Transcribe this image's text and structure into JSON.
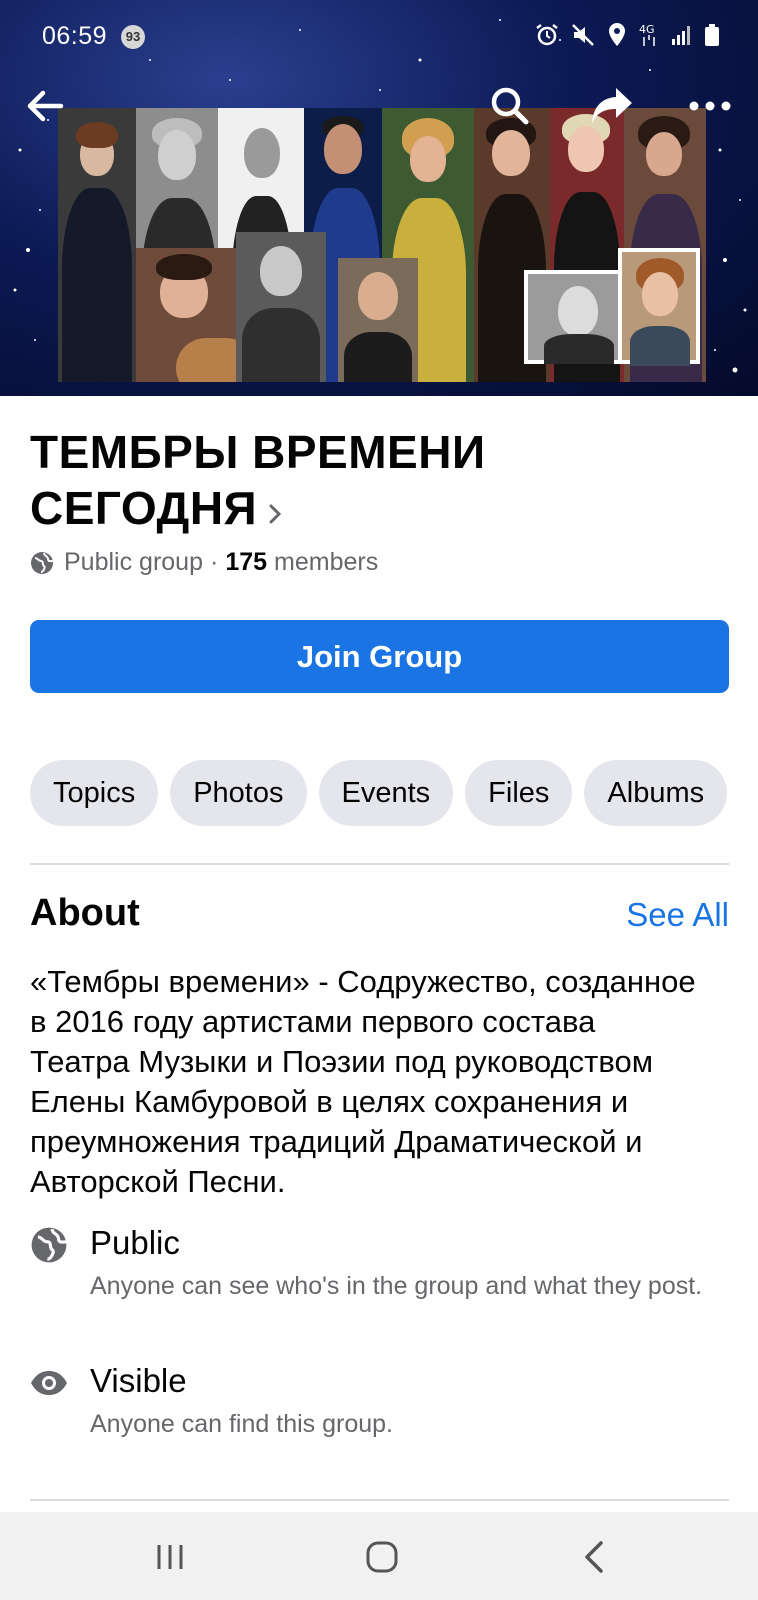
{
  "status_bar": {
    "time": "06:59",
    "notification_count": "93",
    "network": "4G"
  },
  "cover": {
    "actions": [
      "back-arrow-icon",
      "search-icon",
      "share-icon",
      "more-icon"
    ]
  },
  "group": {
    "title": "ТЕМБРЫ ВРЕМЕНИ СЕГОДНЯ",
    "privacy": "Public group",
    "separator": "·",
    "member_count": "175",
    "members_label": "members"
  },
  "join_button": "Join Group",
  "tabs": [
    {
      "label": "Topics"
    },
    {
      "label": "Photos"
    },
    {
      "label": "Events"
    },
    {
      "label": "Files"
    },
    {
      "label": "Albums"
    }
  ],
  "about": {
    "heading": "About",
    "see_all": "See All",
    "description": "«Тембры времени» - Содружество, созданное\nв 2016 году артистами первого состава\nТеатра Музыки  и Поэзии под руководством\nЕлены Камбуровой в целях сохранения и\nпреумножения традиций Драматической и\nАвторской  Песни.",
    "items": [
      {
        "icon": "globe-icon",
        "label": "Public",
        "sub": "Anyone can see who's in the group and what they post."
      },
      {
        "icon": "eye-icon",
        "label": "Visible",
        "sub": "Anyone can find this group."
      }
    ]
  },
  "colors": {
    "accent": "#1b74e4",
    "pill_bg": "#e4e6eb",
    "secondary_text": "#65676b"
  }
}
